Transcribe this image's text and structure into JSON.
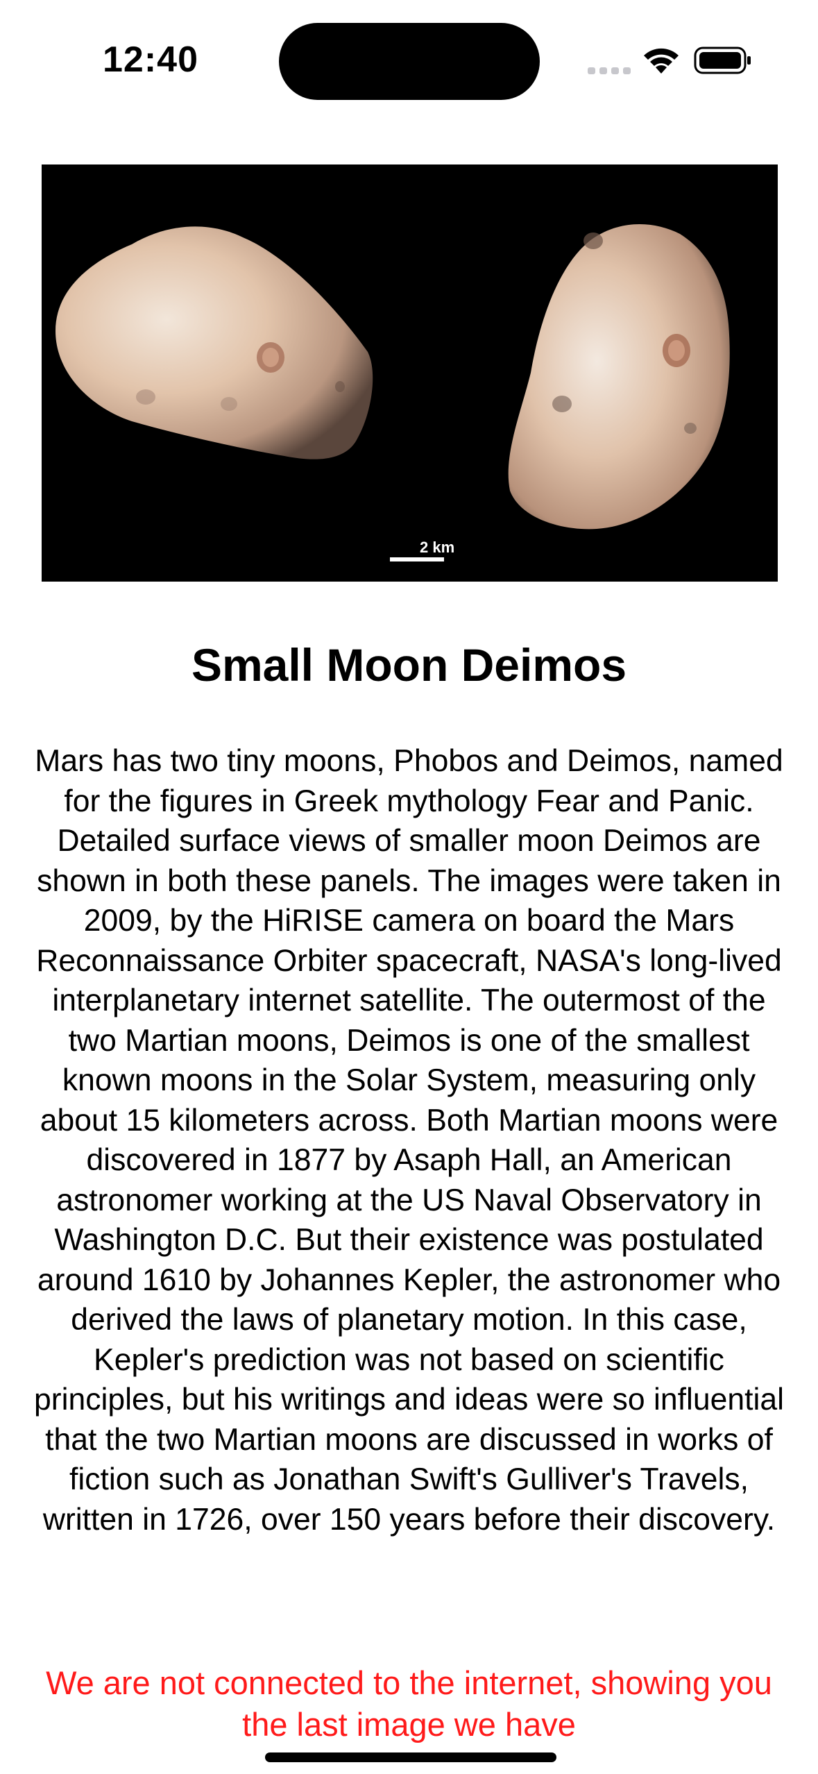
{
  "status_bar": {
    "time": "12:40"
  },
  "hero_image": {
    "scale_label": "2 km"
  },
  "article": {
    "title": "Small Moon Deimos",
    "description": "Mars has two tiny moons, Phobos and Deimos, named for the figures in Greek mythology Fear and Panic. Detailed surface views of smaller moon Deimos are shown in both these panels. The images were taken in 2009, by the HiRISE camera on board the Mars Reconnaissance Orbiter spacecraft, NASA's long-lived interplanetary internet satellite. The outermost of the two Martian moons, Deimos is one of the smallest known moons in the Solar System, measuring only about 15 kilometers across.  Both Martian moons were discovered in 1877 by Asaph Hall, an American astronomer working at the US Naval Observatory in Washington D.C. But their existence was postulated around 1610 by Johannes Kepler, the astronomer who derived the laws of planetary motion. In this case, Kepler's prediction was not based on scientific principles, but his writings and ideas were so influential that the two Martian moons are discussed in works of fiction such as Jonathan Swift's Gulliver's Travels, written in 1726, over 150 years before their discovery."
  },
  "offline_message": "We are not connected to the internet, showing you the last image we have",
  "colors": {
    "offline_text": "#ff1a1a",
    "image_background": "#000000"
  },
  "icons": [
    "cellular-signal-icon",
    "wifi-icon",
    "battery-icon"
  ]
}
